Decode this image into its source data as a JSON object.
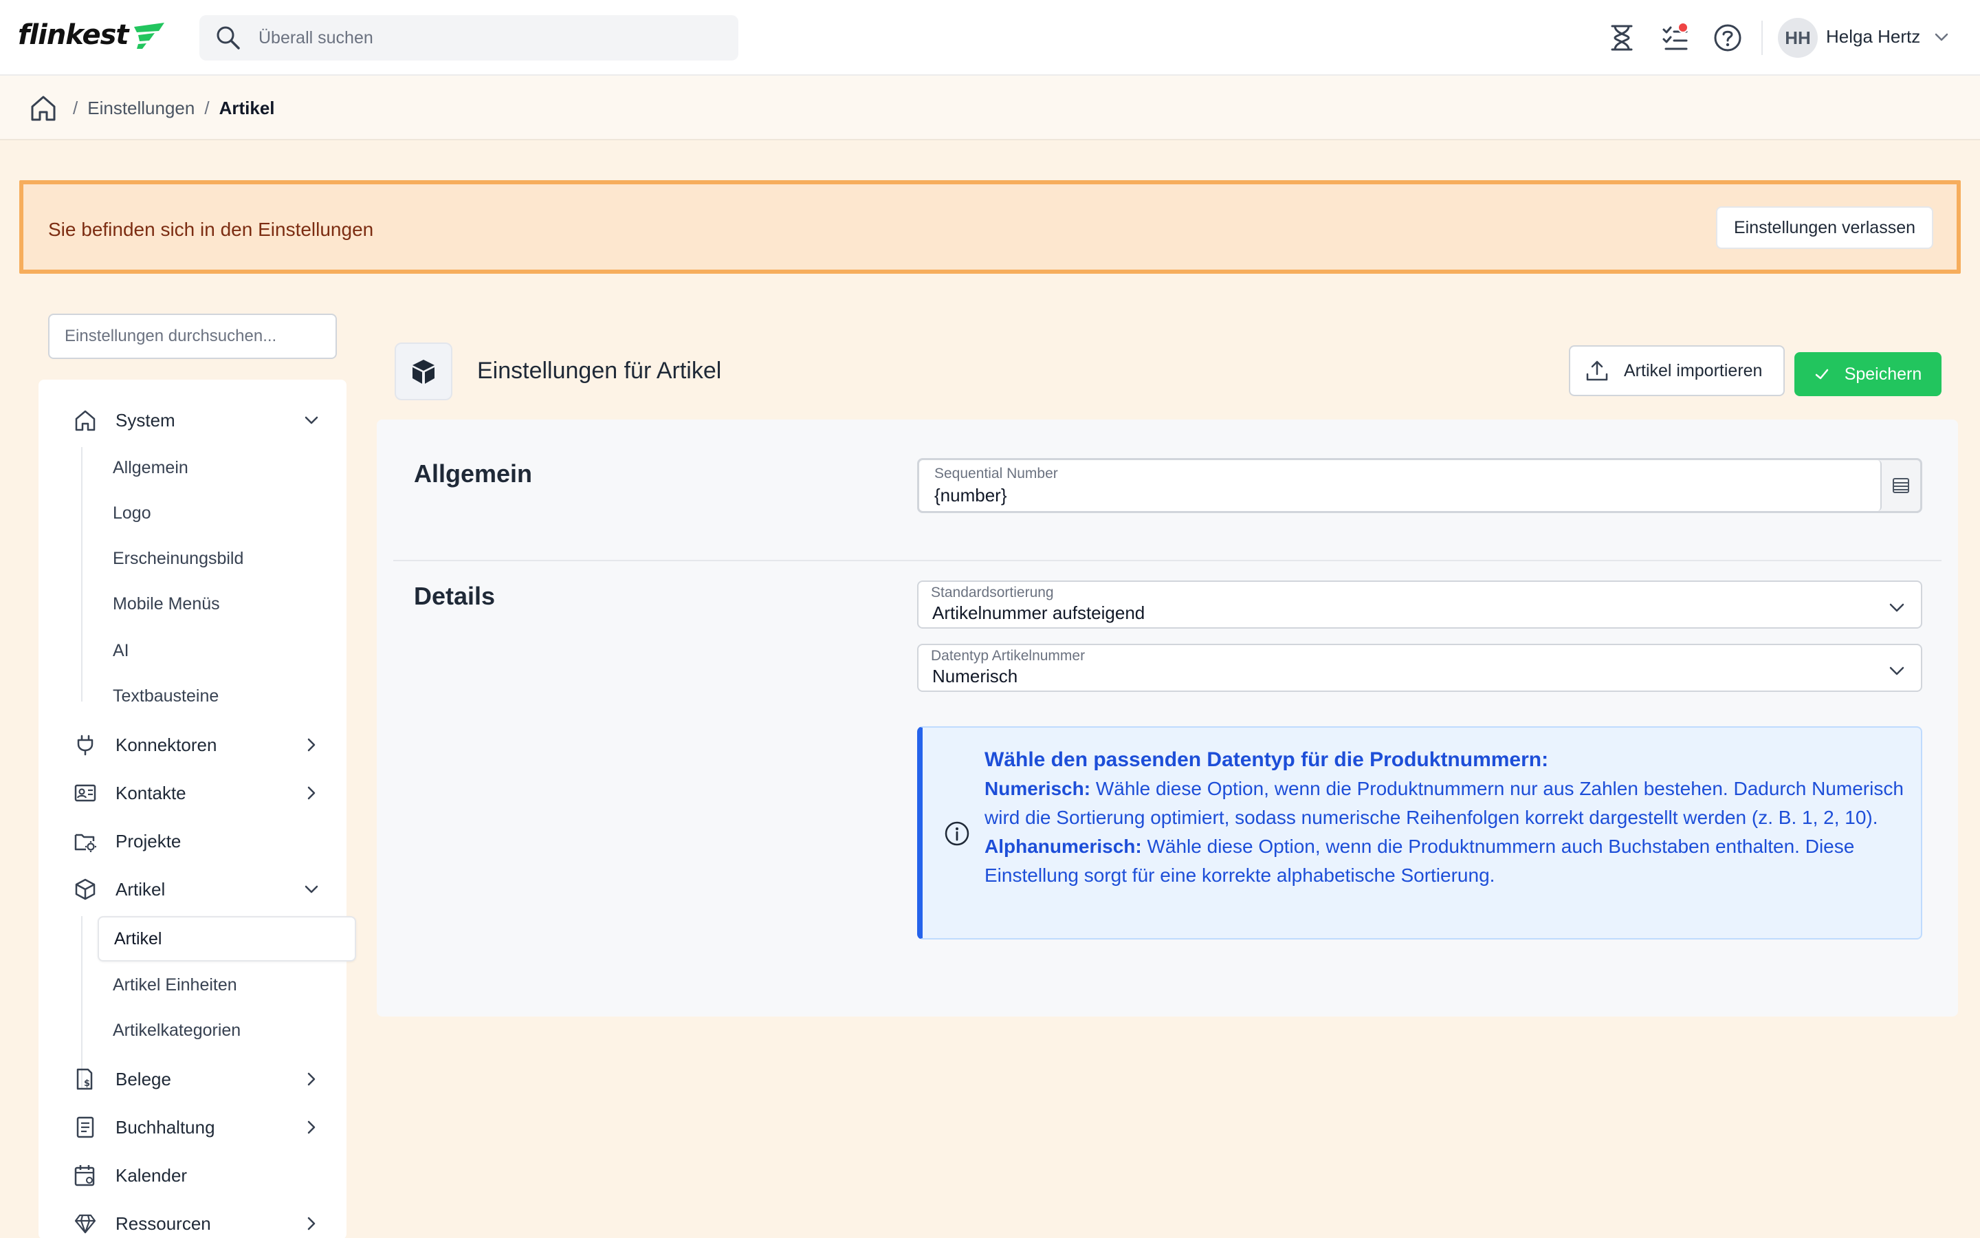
{
  "app": {
    "logo_text": "flinkest",
    "brand_color": "#22c55e",
    "search_placeholder": "Überall suchen"
  },
  "header_icons": [
    "hourglass-icon",
    "tasks-icon",
    "help-icon"
  ],
  "user": {
    "initials": "HH",
    "name": "Helga Hertz"
  },
  "breadcrumb": {
    "items": [
      "Einstellungen",
      "Artikel"
    ]
  },
  "banner": {
    "text": "Sie befinden sich in den Einstellungen",
    "button": "Einstellungen verlassen",
    "color": "#f6ad5c"
  },
  "sidebar": {
    "search_placeholder": "Einstellungen durchsuchen...",
    "items": [
      {
        "label": "System",
        "icon": "home-icon",
        "expanded": true,
        "children": [
          "Allgemein",
          "Logo",
          "Erscheinungsbild",
          "Mobile Menüs",
          "AI",
          "Textbausteine"
        ]
      },
      {
        "label": "Konnektoren",
        "icon": "plug-icon"
      },
      {
        "label": "Kontakte",
        "icon": "contact-card-icon"
      },
      {
        "label": "Projekte",
        "icon": "folder-gear-icon"
      },
      {
        "label": "Artikel",
        "icon": "box-icon",
        "expanded": true,
        "children": [
          "Artikel",
          "Artikel Einheiten",
          "Artikelkategorien"
        ],
        "active_child": "Artikel"
      },
      {
        "label": "Belege",
        "icon": "receipt-icon"
      },
      {
        "label": "Buchhaltung",
        "icon": "ledger-icon"
      },
      {
        "label": "Kalender",
        "icon": "calendar-icon"
      },
      {
        "label": "Ressourcen",
        "icon": "diamond-icon"
      }
    ]
  },
  "page": {
    "title": "Einstellungen für Artikel",
    "import_button": "Artikel importieren",
    "save_button": "Speichern"
  },
  "allgemein": {
    "title": "Allgemein",
    "sequential_label": "Sequential Number",
    "sequential_value": "{number}"
  },
  "details": {
    "title": "Details",
    "sort_label": "Standardsortierung",
    "sort_value": "Artikelnummer aufsteigend",
    "datatype_label": "Datentyp Artikelnummer",
    "datatype_value": "Numerisch"
  },
  "info": {
    "title": "Wähle den passenden Datentyp für die Produktnummern:",
    "numeric_term": "Numerisch:",
    "numeric_text": " Wähle diese Option, wenn die Produktnummern nur aus Zahlen bestehen. Dadurch Numerisch wird die Sortierung optimiert, sodass numerische Reihenfolgen korrekt dargestellt werden (z. B. 1, 2, 10).",
    "alpha_term": "Alphanumerisch:",
    "alpha_text": " Wähle diese Option, wenn die Produktnummern auch Buchstaben enthalten. Diese Einstellung sorgt für eine korrekte alphabetische Sortierung."
  }
}
